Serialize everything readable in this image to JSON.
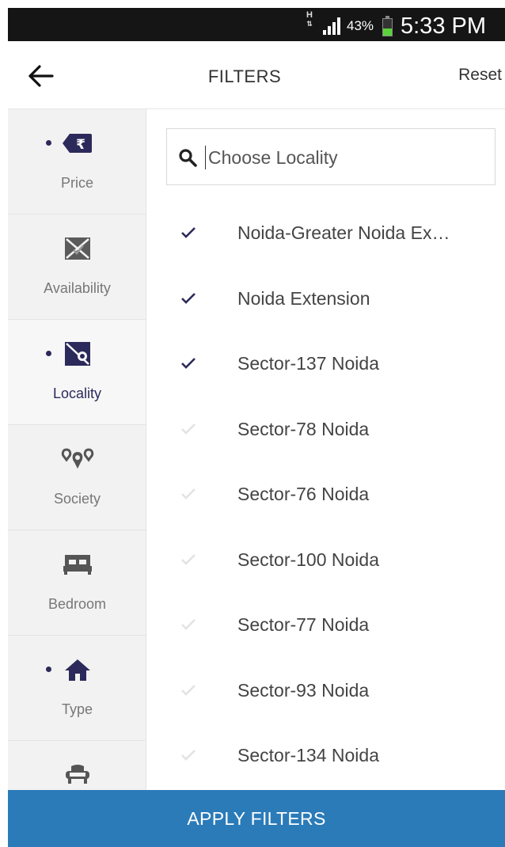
{
  "status_bar": {
    "network_type": "H",
    "battery_percent": "43%",
    "time": "5:33 PM"
  },
  "header": {
    "back_icon": "arrow-left-icon",
    "title": "FILTERS",
    "reset_label": "Reset"
  },
  "sidebar": {
    "items": [
      {
        "label": "Price",
        "icon": "rupee-tag-icon",
        "has_dot": true,
        "active": false
      },
      {
        "label": "Availability",
        "icon": "availability-icon",
        "has_dot": false,
        "active": false
      },
      {
        "label": "Locality",
        "icon": "locality-map-icon",
        "has_dot": true,
        "active": true
      },
      {
        "label": "Society",
        "icon": "society-pins-icon",
        "has_dot": false,
        "active": false
      },
      {
        "label": "Bedroom",
        "icon": "bed-icon",
        "has_dot": false,
        "active": false
      },
      {
        "label": "Type",
        "icon": "home-icon",
        "has_dot": true,
        "active": false
      },
      {
        "label": "",
        "icon": "sofa-icon",
        "has_dot": false,
        "active": false
      }
    ]
  },
  "search": {
    "placeholder": "Choose Locality",
    "value": ""
  },
  "localities": [
    {
      "label": "Noida-Greater Noida Ex…",
      "selected": true
    },
    {
      "label": "Noida Extension",
      "selected": true
    },
    {
      "label": "Sector-137 Noida",
      "selected": true
    },
    {
      "label": "Sector-78 Noida",
      "selected": false
    },
    {
      "label": "Sector-76 Noida",
      "selected": false
    },
    {
      "label": "Sector-100 Noida",
      "selected": false
    },
    {
      "label": "Sector-77 Noida",
      "selected": false
    },
    {
      "label": "Sector-93 Noida",
      "selected": false
    },
    {
      "label": "Sector-134 Noida",
      "selected": false
    }
  ],
  "apply_label": "APPLY FILTERS",
  "colors": {
    "accent": "#2c2a5a",
    "apply_bar": "#2b7bb9",
    "check_inactive": "#e3e3e3"
  }
}
